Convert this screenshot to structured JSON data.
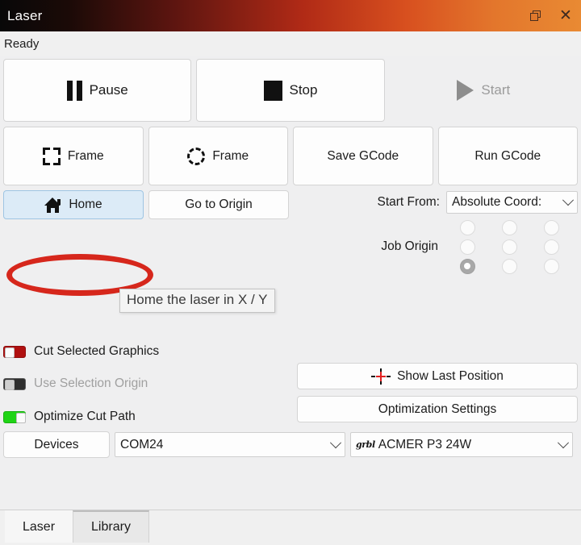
{
  "window": {
    "title": "Laser",
    "restore_icon": "restore-icon",
    "close_icon": "close-icon",
    "status": "Ready"
  },
  "transport": [
    {
      "label": "Pause",
      "icon": "pause-icon",
      "enabled": true
    },
    {
      "label": "Stop",
      "icon": "stop-icon",
      "enabled": true
    },
    {
      "label": "Start",
      "icon": "play-icon",
      "enabled": false
    }
  ],
  "actions": [
    {
      "label": "Frame",
      "icon": "bracket-frame-icon"
    },
    {
      "label": "Frame",
      "icon": "dashed-circle-frame-icon"
    },
    {
      "label": "Save GCode",
      "icon": ""
    },
    {
      "label": "Run GCode",
      "icon": ""
    }
  ],
  "home_row": {
    "home_label": "Home",
    "home_icon": "house-icon",
    "origin_label": "Go to Origin"
  },
  "tooltip": {
    "text": "Home the laser in X / Y"
  },
  "start_from": {
    "label": "Start From:",
    "value": "Absolute Coord:",
    "chevron_icon": "chevron-down-icon"
  },
  "job_origin": {
    "label": "Job Origin",
    "rows": 3,
    "cols": 3,
    "selected_index": 6
  },
  "toggles": [
    {
      "label": "Cut Selected Graphics",
      "state": "off",
      "color": "#b01010",
      "enabled": true
    },
    {
      "label": "Use Selection Origin",
      "state": "off",
      "color": "#2e2e2e",
      "enabled": false
    },
    {
      "label": "Optimize Cut Path",
      "state": "on",
      "color": "#1fd415",
      "enabled": true
    }
  ],
  "side_buttons": [
    {
      "label": "Show Last Position",
      "icon": "crosshair-icon"
    },
    {
      "label": "Optimization Settings",
      "icon": ""
    }
  ],
  "devices": {
    "button_label": "Devices",
    "port": "COM24",
    "device_prefix": "grbl",
    "device": "ACMER P3 24W"
  },
  "tabs": [
    {
      "label": "Laser",
      "active": true
    },
    {
      "label": "Library",
      "active": false
    }
  ],
  "colors": {
    "annotation": "#d6271c",
    "titlebar_left": "#080808",
    "titlebar_right": "#e98a33",
    "hover_blue": "#dcebf7",
    "toggle_on": "#1fd415",
    "toggle_off": "#b01010"
  }
}
